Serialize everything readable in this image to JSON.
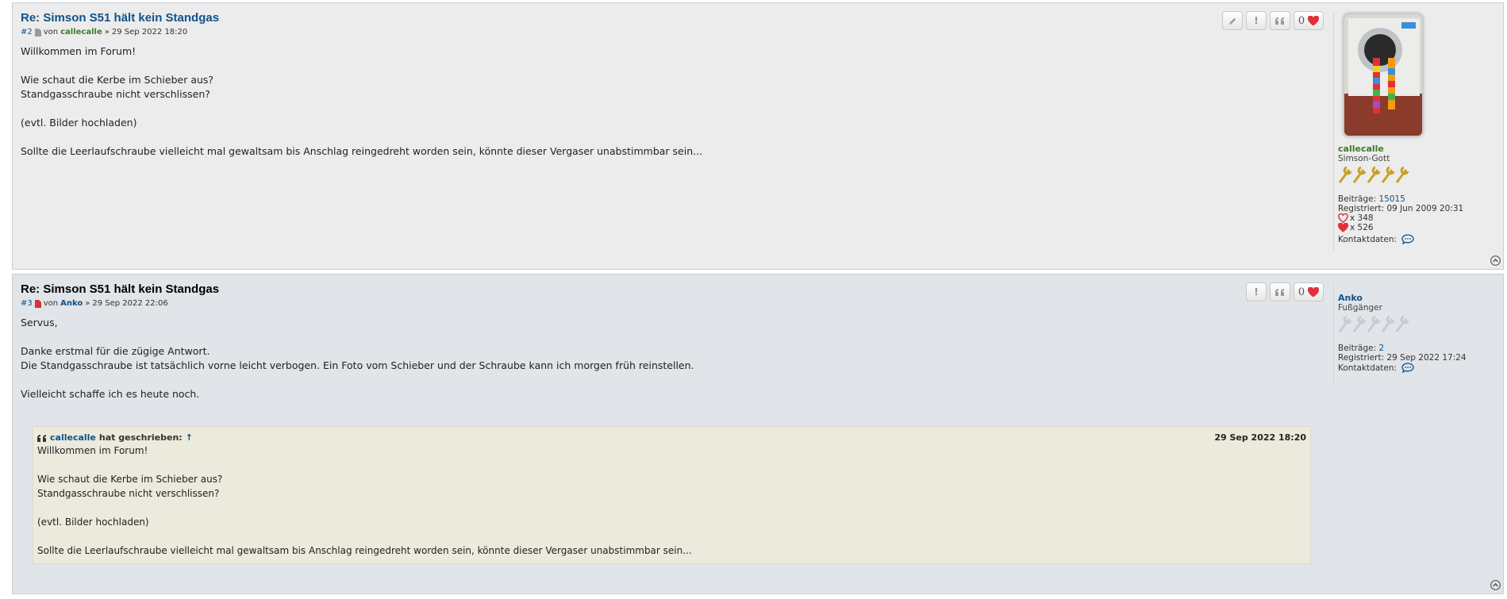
{
  "posts": [
    {
      "title": "Re: Simson S51 hält kein Standgas",
      "number": "#2",
      "by": "von",
      "author": "callecalle",
      "separator": "»",
      "date": "29 Sep 2022 18:20",
      "like_count": "0",
      "lines": [
        "Willkommen im Forum!",
        "",
        "Wie schaut die Kerbe im Schieber aus?",
        "Standgasschraube nicht verschlissen?",
        "",
        "(evtl. Bilder hochladen)",
        "",
        "Sollte die Leerlaufschraube vielleicht mal gewaltsam bis Anschlag reingedreht worden sein, könnte dieser Vergaser unabstimmbar sein..."
      ],
      "profile": {
        "name": "callecalle",
        "rank": "Simson-Gott",
        "posts_label": "Beiträge:",
        "posts_value": "15015",
        "registered_label": "Registriert:",
        "registered_value": "09 Jun 2009 20:31",
        "likes_given": "x 348",
        "likes_received": "x 526",
        "contact_label": "Kontaktdaten:"
      }
    },
    {
      "title": "Re: Simson S51 hält kein Standgas",
      "number": "#3",
      "by": "von",
      "author": "Anko",
      "separator": "»",
      "date": "29 Sep 2022 22:06",
      "like_count": "0",
      "lines": [
        "Servus,",
        "",
        "Danke erstmal für die zügige Antwort.",
        "Die Standgasschraube ist tatsächlich vorne leicht verbogen. Ein Foto vom Schieber und der Schraube kann ich morgen früh reinstellen.",
        "",
        "Vielleicht schaffe ich es heute noch."
      ],
      "quote": {
        "author": "callecalle",
        "wrote": "hat geschrieben:",
        "arrow": "↑",
        "date": "29 Sep 2022 18:20",
        "lines": [
          "Willkommen im Forum!",
          "",
          "Wie schaut die Kerbe im Schieber aus?",
          "Standgasschraube nicht verschlissen?",
          "",
          "(evtl. Bilder hochladen)",
          "",
          "Sollte die Leerlaufschraube vielleicht mal gewaltsam bis Anschlag reingedreht worden sein, könnte dieser Vergaser unabstimmbar sein..."
        ]
      },
      "profile": {
        "name": "Anko",
        "rank": "Fußgänger",
        "posts_label": "Beiträge:",
        "posts_value": "2",
        "registered_label": "Registriert:",
        "registered_value": "29 Sep 2022 17:24",
        "contact_label": "Kontaktdaten:"
      }
    }
  ],
  "colors": {
    "link_blue": "#105289",
    "user_green": "#3d7a2a",
    "heart_red": "#e0303a",
    "post_bg_a": "#ececec",
    "post_bg_b": "#e1e4e8",
    "quote_bg": "#ebeadd"
  },
  "icons": {
    "edit": "pencil-icon",
    "report": "exclamation-icon",
    "quote": "quote-icon",
    "like": "heart-icon",
    "contact": "speech-bubble-icon",
    "top": "arrow-up-circle-icon",
    "rank": "wrench-icon"
  }
}
